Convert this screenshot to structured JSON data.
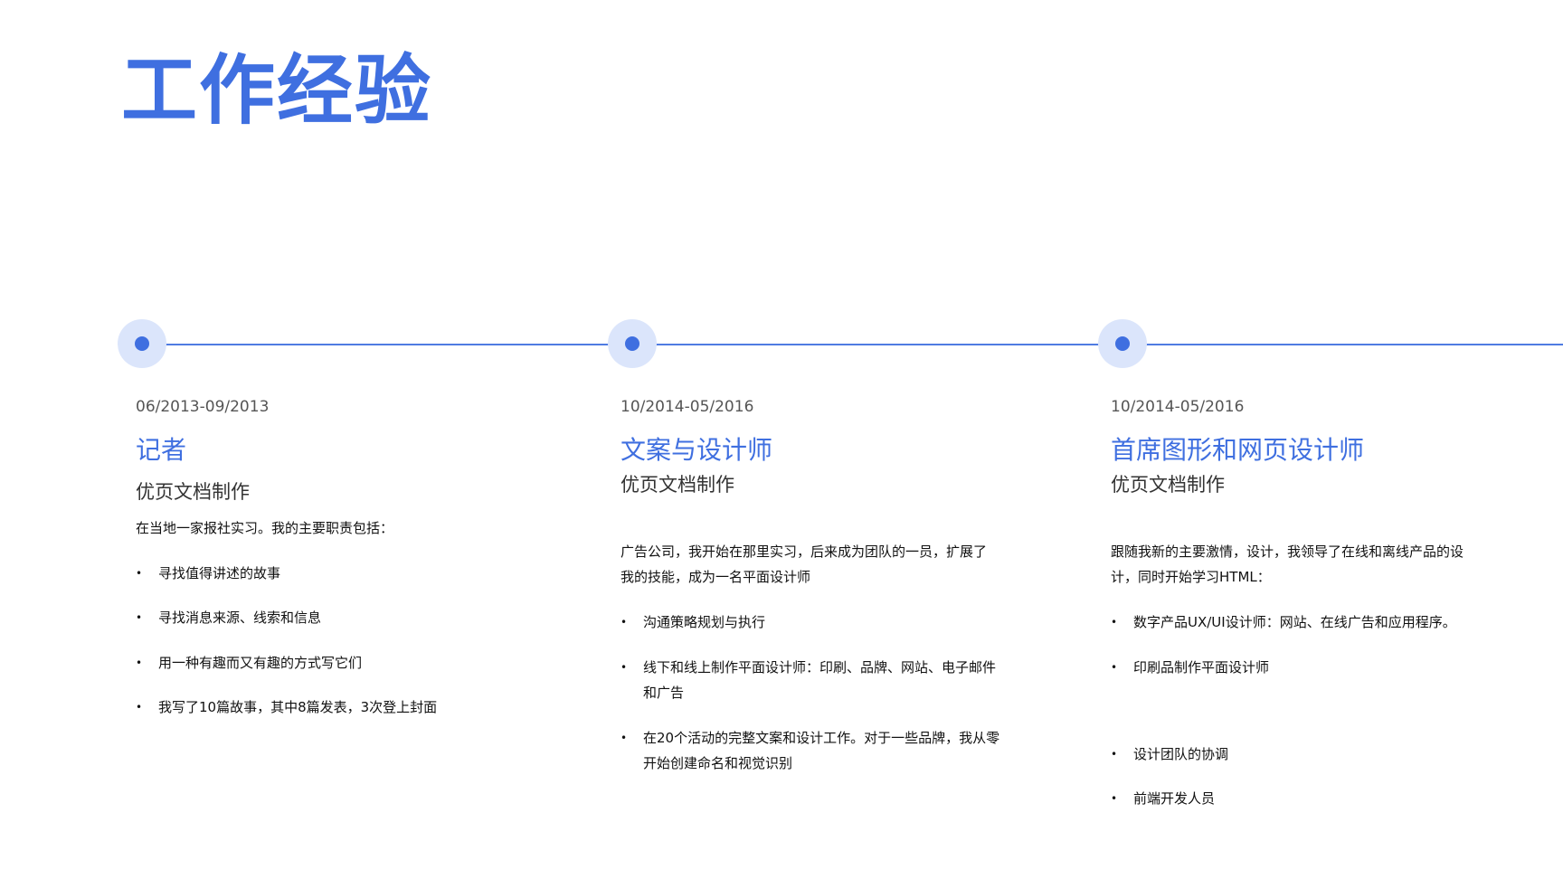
{
  "page": {
    "title": "工作经验"
  },
  "colors": {
    "accent": "#3f6fe0",
    "node_halo": "#dbe5fb",
    "line": "#4f7be2"
  },
  "experiences": [
    {
      "date": "06/2013-09/2013",
      "role": "记者",
      "company": "优页文档制作",
      "intro": "在当地一家报社实习。我的主要职责包括：",
      "bullets": [
        "寻找值得讲述的故事",
        "寻找消息来源、线索和信息",
        "用一种有趣而又有趣的方式写它们",
        "我写了10篇故事，其中8篇发表，3次登上封面"
      ]
    },
    {
      "date": "10/2014-05/2016",
      "role": "文案与设计师",
      "company": "优页文档制作",
      "intro": "广告公司，我开始在那里实习，后来成为团队的一员，扩展了我的技能，成为一名平面设计师",
      "bullets": [
        "沟通策略规划与执行",
        "线下和线上制作平面设计师：印刷、品牌、网站、电子邮件和广告",
        "在20个活动的完整文案和设计工作。对于一些品牌，我从零开始创建命名和视觉识别"
      ]
    },
    {
      "date": "10/2014-05/2016",
      "role": "首席图形和网页设计师",
      "company": "优页文档制作",
      "intro": "跟随我新的主要激情，设计，我领导了在线和离线产品的设计，同时开始学习HTML：",
      "bullets": [
        "数字产品UX/UI设计师：网站、在线广告和应用程序。",
        "印刷品制作平面设计师",
        "设计团队的协调",
        "前端开发人员"
      ]
    }
  ]
}
